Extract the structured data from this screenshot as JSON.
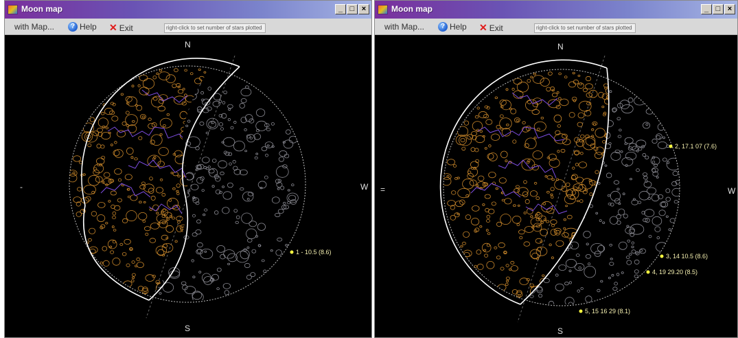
{
  "left": {
    "title": "Moon map",
    "menu": {
      "map_label": "with Map...",
      "help_label": "Help",
      "exit_label": "Exit"
    },
    "status": "right-click to set number of stars plotted",
    "compass": {
      "n": "N",
      "s": "S",
      "e": "-",
      "w": "W"
    },
    "labels": [
      "1 - 10.5 (8.6)"
    ]
  },
  "right": {
    "title": "Moon map",
    "menu": {
      "map_label": "with Map...",
      "help_label": "Help",
      "exit_label": "Exit"
    },
    "status": "right-click to set number of stars plotted",
    "compass": {
      "n": "N",
      "s": "S",
      "e": "=",
      "w": "W"
    },
    "labels": [
      "2, 17.1 07 (7.6)",
      "3, 14 10.5 (8.6)",
      "4, 19 29.20 (8.5)",
      "5, 15 16 29 (8.1)"
    ]
  },
  "icons": [
    "app-icon",
    "minimize-icon",
    "maximize-icon",
    "close-icon",
    "help-icon",
    "exit-icon"
  ],
  "colors": {
    "titlebar_start": "#7a2f9c",
    "titlebar_end": "#a5b4e4",
    "lit_craters": "#c8862a",
    "maria": "#7d4de0",
    "dark_craters": "#8a8a92",
    "terminator": "#ffffff",
    "star": "#ffff40"
  }
}
